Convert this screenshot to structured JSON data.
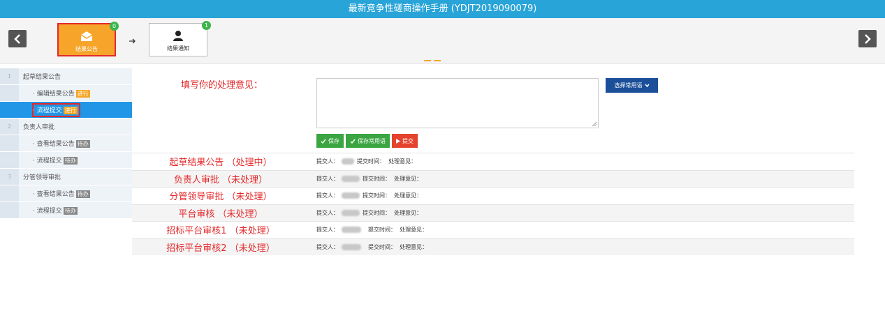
{
  "window": {
    "title": "最新竞争性磋商操作手册 (YDJT2019090079)"
  },
  "stepbar": {
    "steps": [
      {
        "label": "结果公告",
        "badge": "0",
        "icon": "envelope-icon"
      },
      {
        "label": "结果通知",
        "badge": "1",
        "icon": "user-icon"
      }
    ]
  },
  "sidebar": {
    "groups": [
      {
        "num": "1",
        "label": "起草结果公告",
        "items": [
          {
            "label": "· 编辑结果公告",
            "tag": "进行"
          },
          {
            "label": "· 流程提交",
            "tag": "进行"
          }
        ]
      },
      {
        "num": "2",
        "label": "负责人审批",
        "items": [
          {
            "label": "· 查看结果公告",
            "tag": "待办"
          },
          {
            "label": "· 流程提交",
            "tag": "待办"
          }
        ]
      },
      {
        "num": "3",
        "label": "分管领导审批",
        "items": [
          {
            "label": "· 查看结果公告",
            "tag": "待办"
          },
          {
            "label": "· 流程提交",
            "tag": "待办"
          }
        ]
      }
    ]
  },
  "form": {
    "opinion_label": "填写你的处理意见：",
    "opinion_value": "",
    "phrase_button": "选择常用语",
    "save_button": "保存",
    "save_phrase_button": "保存常用语",
    "submit_button": "提交"
  },
  "records": [
    {
      "name": "起草结果公告 （处理中）"
    },
    {
      "name": "负责人审批 （未处理）"
    },
    {
      "name": "分管领导审批 （未处理）"
    },
    {
      "name": "平台审核 （未处理）"
    },
    {
      "name": "招标平台审核1 （未处理）"
    },
    {
      "name": "招标平台审核2 （未处理）"
    }
  ],
  "record_fields": {
    "submitter": "提交人：",
    "submit_time": "提交时间：",
    "opinion": "处理意见："
  },
  "colors": {
    "titlebar": "#28a4d8",
    "active_step": "#f7a42a",
    "highlight": "#e4282a",
    "selected": "#2196e6"
  }
}
